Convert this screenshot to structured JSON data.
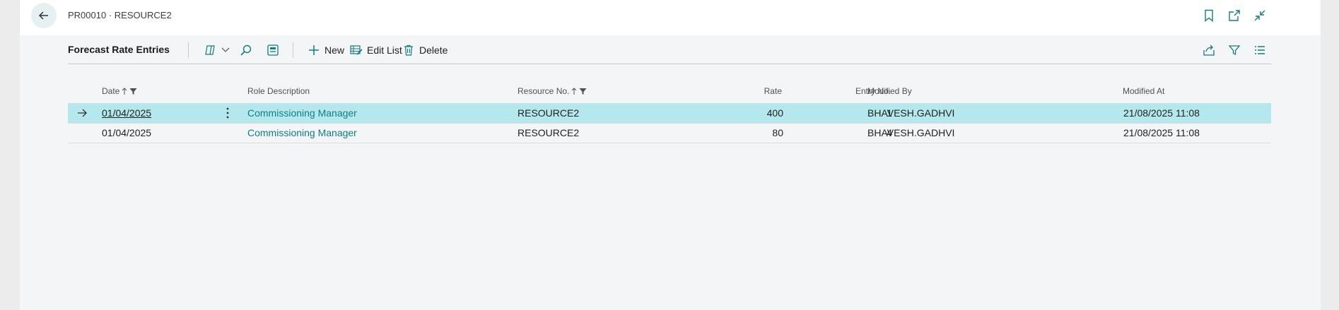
{
  "header": {
    "title": "PR00010 · RESOURCE2",
    "icons": [
      "back-arrow-icon",
      "bookmark-icon",
      "open-new-window-icon",
      "collapse-icon"
    ]
  },
  "toolbar": {
    "title": "Forecast Rate Entries",
    "new_label": "New",
    "edit_list_label": "Edit List",
    "delete_label": "Delete"
  },
  "columns": {
    "date": "Date",
    "role_description": "Role Description",
    "resource_no": "Resource No.",
    "rate": "Rate",
    "entry_no": "Entry No.",
    "modified_by": "Modified By",
    "modified_at": "Modified At"
  },
  "rows": [
    {
      "date": "01/04/2025",
      "role_description": "Commissioning Manager",
      "resource_no": "RESOURCE2",
      "rate": "400",
      "entry_no": "1",
      "modified_by": "BHAVESH.GADHVI",
      "modified_at": "21/08/2025 11:08",
      "selected": true
    },
    {
      "date": "01/04/2025",
      "role_description": "Commissioning Manager",
      "resource_no": "RESOURCE2",
      "rate": "80",
      "entry_no": "4",
      "modified_by": "BHAVESH.GADHVI",
      "modified_at": "21/08/2025 11:08",
      "selected": false
    }
  ],
  "colors": {
    "accent": "#0f7d84",
    "selected_row": "#b5e8ec",
    "back_button": "#e6eff2"
  }
}
